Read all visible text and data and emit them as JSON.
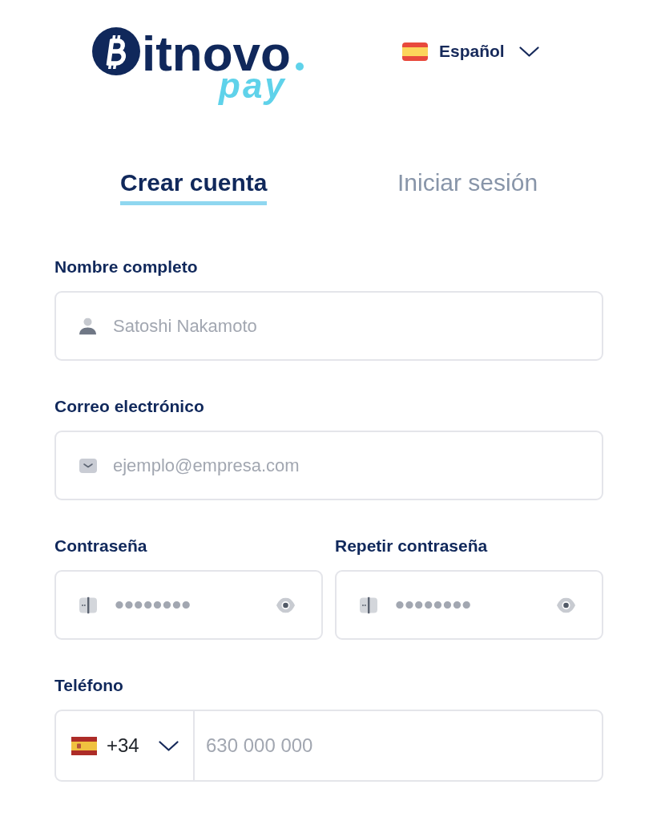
{
  "header": {
    "logo": {
      "wordmark": "itnovo",
      "tagline": "pay"
    },
    "language": {
      "label": "Español"
    }
  },
  "tabs": [
    {
      "label": "Crear cuenta",
      "selected": true
    },
    {
      "label": "Iniciar sesión",
      "selected": false
    }
  ],
  "form": {
    "rows": [
      {
        "fields": [
          {
            "kind": "text",
            "label": "Nombre completo",
            "placeholder": "Satoshi Nakamoto"
          }
        ]
      },
      {
        "fields": [
          {
            "kind": "email",
            "label": "Correo electrónico",
            "placeholder": "ejemplo@empresa.com"
          }
        ]
      },
      {
        "fields": [
          {
            "kind": "password",
            "label": "Contraseña",
            "placeholder": "••••••••"
          },
          {
            "kind": "password",
            "label": "Repetir contraseña",
            "placeholder": "••••••••"
          }
        ]
      },
      {
        "fields": [
          {
            "kind": "phone",
            "label": "Teléfono",
            "country_code": "+34",
            "placeholder": "630 000 000"
          }
        ]
      }
    ]
  }
}
